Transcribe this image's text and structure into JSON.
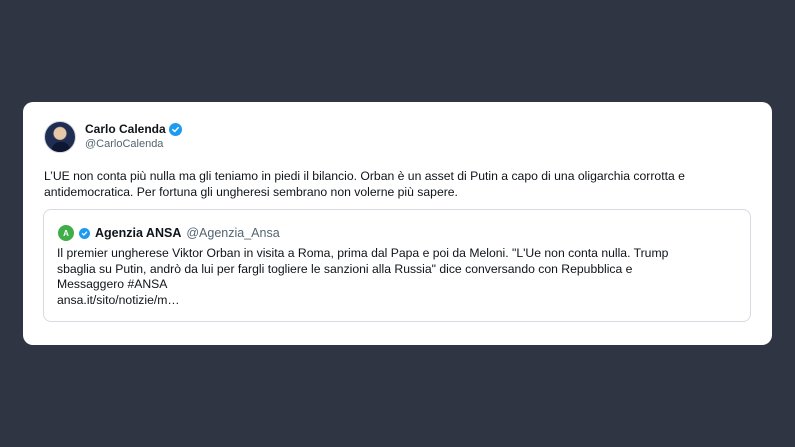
{
  "tweet": {
    "author": {
      "display_name": "Carlo Calenda",
      "handle": "@CarloCalenda",
      "verified": true
    },
    "text_lines": [
      "L’UE non conta più nulla ma gli teniamo in piedi il bilancio. Orban è un asset di Putin a capo di una oligarchia corrotta e",
      "antidemocratica. Per fortuna gli ungheresi sembrano non volerne più sapere."
    ]
  },
  "quoted_tweet": {
    "logo_text": "A",
    "display_name": "Agenzia ANSA",
    "handle": "@Agenzia_Ansa",
    "verified": true,
    "text_lines": [
      "Il premier ungherese Viktor Orban in visita a Roma, prima dal Papa e poi da Meloni. \"L'Ue non conta nulla. Trump",
      "sbaglia su Putin, andrò da lui per fargli togliere le sanzioni alla Russia\" dice conversando con Repubblica e",
      "Messaggero #ANSA",
      "ansa.it/sito/notizie/m…"
    ]
  },
  "colors": {
    "background": "#2f3542",
    "card": "#ffffff",
    "verified_blue": "#1d9bf0",
    "ansa_green": "#3fae49",
    "secondary_text": "#536471"
  }
}
